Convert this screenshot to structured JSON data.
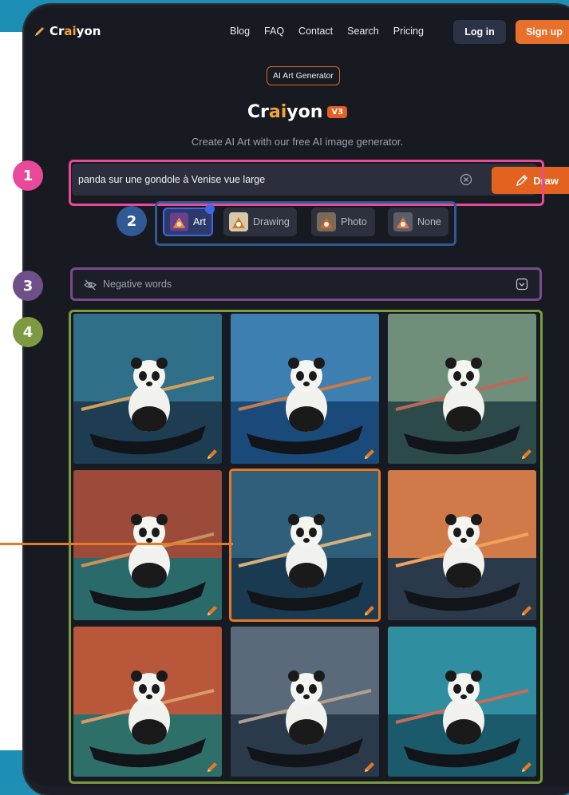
{
  "app": {
    "logo_prefix": "Cr",
    "logo_highlight": "ai",
    "logo_suffix": "yon"
  },
  "nav": {
    "links": [
      "Blog",
      "FAQ",
      "Contact",
      "Search",
      "Pricing"
    ],
    "login": "Log in",
    "signup": "Sign up"
  },
  "hero": {
    "badge": "AI Art Generator",
    "title_prefix": "Cr",
    "title_highlight": "ai",
    "title_suffix": "yon",
    "version": "V3",
    "subtitle": "Create AI Art with our free AI image generator."
  },
  "prompt": {
    "value": "panda sur une gondole à Venise vue large",
    "draw_label": "Draw"
  },
  "styles": {
    "options": [
      {
        "label": "Art",
        "active": true
      },
      {
        "label": "Drawing",
        "active": false
      },
      {
        "label": "Photo",
        "active": false
      },
      {
        "label": "None",
        "active": false
      }
    ]
  },
  "negative": {
    "label": "Negative words"
  },
  "results": {
    "count": 9,
    "selected_index": 4
  },
  "callouts": [
    "1",
    "2",
    "3",
    "4"
  ],
  "colors": {
    "accent_orange": "#e3621f",
    "callout_pink": "#e9499b",
    "callout_blue": "#2f5a94",
    "callout_purple": "#7a4b8c",
    "callout_green": "#7d9a42"
  }
}
